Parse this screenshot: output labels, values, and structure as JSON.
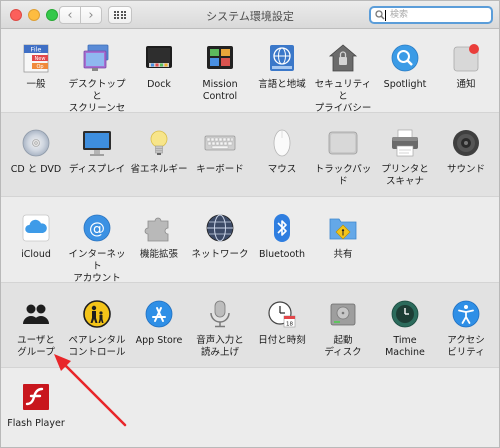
{
  "window": {
    "title": "システム環境設定",
    "search_placeholder": "検索",
    "search_value": ""
  },
  "sections": [
    {
      "items": [
        {
          "label": "一般",
          "icon": "general-icon"
        },
        {
          "label": "デスクトップと\nスクリーンセーバ",
          "icon": "desktop-icon"
        },
        {
          "label": "Dock",
          "icon": "dock-icon"
        },
        {
          "label": "Mission\nControl",
          "icon": "mission-control-icon"
        },
        {
          "label": "言語と地域",
          "icon": "language-globe-icon"
        },
        {
          "label": "セキュリティと\nプライバシー",
          "icon": "security-house-icon"
        },
        {
          "label": "Spotlight",
          "icon": "spotlight-icon"
        },
        {
          "label": "通知",
          "icon": "notifications-icon"
        }
      ]
    },
    {
      "items": [
        {
          "label": "CD と DVD",
          "icon": "cd-dvd-icon"
        },
        {
          "label": "ディスプレイ",
          "icon": "display-icon"
        },
        {
          "label": "省エネルギー",
          "icon": "lightbulb-icon"
        },
        {
          "label": "キーボード",
          "icon": "keyboard-icon"
        },
        {
          "label": "マウス",
          "icon": "mouse-icon"
        },
        {
          "label": "トラックパッド",
          "icon": "trackpad-icon"
        },
        {
          "label": "プリンタと\nスキャナ",
          "icon": "printer-icon"
        },
        {
          "label": "サウンド",
          "icon": "speaker-icon"
        }
      ]
    },
    {
      "items": [
        {
          "label": "iCloud",
          "icon": "icloud-icon"
        },
        {
          "label": "インターネット\nアカウント",
          "icon": "at-sign-icon"
        },
        {
          "label": "機能拡張",
          "icon": "puzzle-icon"
        },
        {
          "label": "ネットワーク",
          "icon": "network-globe-icon"
        },
        {
          "label": "Bluetooth",
          "icon": "bluetooth-icon"
        },
        {
          "label": "共有",
          "icon": "sharing-folder-icon"
        }
      ]
    },
    {
      "items": [
        {
          "label": "ユーザと\nグループ",
          "icon": "users-icon"
        },
        {
          "label": "ペアレンタル\nコントロール",
          "icon": "parental-controls-icon"
        },
        {
          "label": "App Store",
          "icon": "app-store-icon"
        },
        {
          "label": "音声入力と\n読み上げ",
          "icon": "microphone-icon"
        },
        {
          "label": "日付と時刻",
          "icon": "clock-calendar-icon"
        },
        {
          "label": "起動\nディスク",
          "icon": "startup-disk-icon"
        },
        {
          "label": "Time\nMachine",
          "icon": "time-machine-icon"
        },
        {
          "label": "アクセシ\nビリティ",
          "icon": "accessibility-icon"
        }
      ]
    },
    {
      "items": [
        {
          "label": "Flash Player",
          "icon": "flash-player-icon"
        }
      ]
    }
  ],
  "colors": {
    "accent": "#5b9dd9",
    "annotation_arrow": "#e8262a"
  }
}
